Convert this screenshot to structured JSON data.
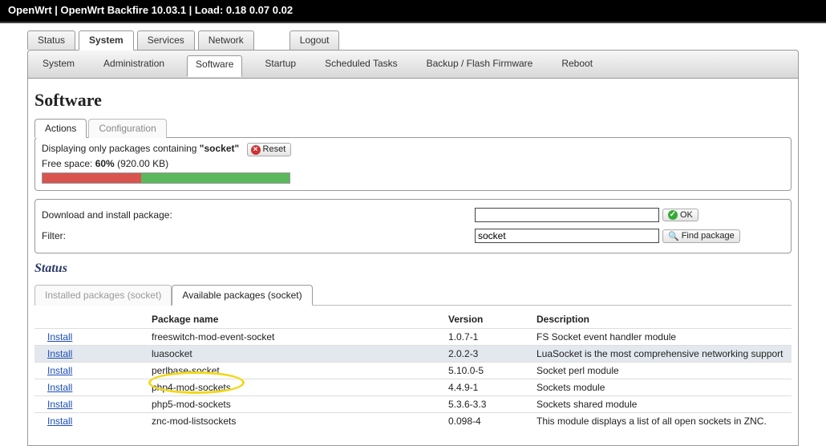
{
  "topbar": "OpenWrt | OpenWrt Backfire 10.03.1 | Load: 0.18 0.07 0.02",
  "main_tabs": {
    "status": "Status",
    "system": "System",
    "services": "Services",
    "network": "Network",
    "logout": "Logout"
  },
  "sub_tabs": {
    "system": "System",
    "administration": "Administration",
    "software": "Software",
    "startup": "Startup",
    "scheduled": "Scheduled Tasks",
    "backup": "Backup / Flash Firmware",
    "reboot": "Reboot"
  },
  "page_title": "Software",
  "section_tabs": {
    "actions": "Actions",
    "configuration": "Configuration"
  },
  "filter_msg_prefix": "Displaying only packages containing ",
  "filter_term_quoted": "\"socket\"",
  "reset_label": "Reset",
  "free_space": {
    "prefix": "Free space: ",
    "pct": "60%",
    "size": "(920.00 KB)",
    "suffix": ")"
  },
  "download_label": "Download and install package:",
  "ok_label": "OK",
  "filter_label": "Filter:",
  "filter_value": "socket",
  "find_label": "Find package",
  "status_heading": "Status",
  "pkg_tabs": {
    "installed": "Installed packages (socket)",
    "available": "Available packages (socket)"
  },
  "columns": {
    "action": "",
    "name": "Package name",
    "version": "Version",
    "description": "Description"
  },
  "install_label": "Install",
  "packages": [
    {
      "name": "freeswitch-mod-event-socket",
      "version": "1.0.7-1",
      "desc": "FS Socket event handler module"
    },
    {
      "name": "luasocket",
      "version": "2.0.2-3",
      "desc": "LuaSocket is the most comprehensive networking support",
      "hl": true
    },
    {
      "name": "perlbase-socket",
      "version": "5.10.0-5",
      "desc": "Socket perl module"
    },
    {
      "name": "php4-mod-sockets",
      "version": "4.4.9-1",
      "desc": "Sockets module"
    },
    {
      "name": "php5-mod-sockets",
      "version": "5.3.6-3.3",
      "desc": "Sockets shared module"
    },
    {
      "name": "znc-mod-listsockets",
      "version": "0.098-4",
      "desc": "This module displays a list of all open sockets in ZNC."
    }
  ]
}
